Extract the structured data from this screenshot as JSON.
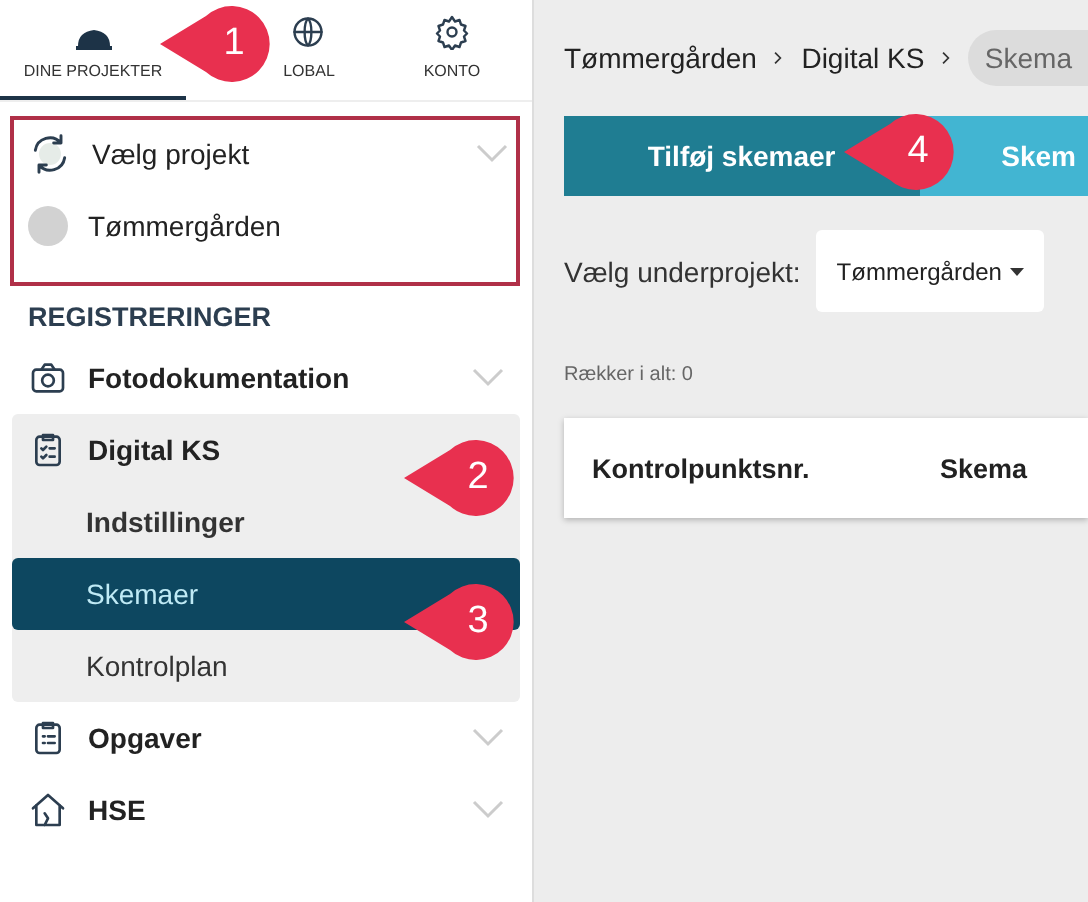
{
  "nav_tabs": [
    {
      "label": "DINE PROJEKTER",
      "selected": true
    },
    {
      "label": "LOBAL",
      "selected": false
    },
    {
      "label": "KONTO",
      "selected": false
    }
  ],
  "project": {
    "picker_label": "Vælg projekt",
    "current": "Tømmergården"
  },
  "section_heading": "REGISTRERINGER",
  "menu": [
    {
      "label": "Fotodokumentation",
      "expanded": false
    },
    {
      "label": "Digital KS",
      "expanded": true,
      "children": [
        {
          "label": "Indstillinger",
          "kind": "heading",
          "selected": false
        },
        {
          "label": "Skemaer",
          "kind": "link",
          "selected": true
        },
        {
          "label": "Kontrolplan",
          "kind": "link",
          "selected": false
        }
      ]
    },
    {
      "label": "Opgaver",
      "expanded": false
    },
    {
      "label": "HSE",
      "expanded": false
    }
  ],
  "breadcrumb": [
    {
      "label": "Tømmergården",
      "current": false
    },
    {
      "label": "Digital KS",
      "current": false
    },
    {
      "label": "Skema",
      "current": true
    }
  ],
  "actions": [
    {
      "label": "Tilføj skemaer",
      "kind": "primary"
    },
    {
      "label": "Skem",
      "kind": "secondary"
    }
  ],
  "subproject": {
    "label": "Vælg underprojekt:",
    "value": "Tømmergården"
  },
  "row_count": "Rækker i alt: 0",
  "table": {
    "columns": [
      "Kontrolpunktsnr.",
      "Skema"
    ]
  },
  "callouts": [
    "1",
    "2",
    "3",
    "4"
  ]
}
